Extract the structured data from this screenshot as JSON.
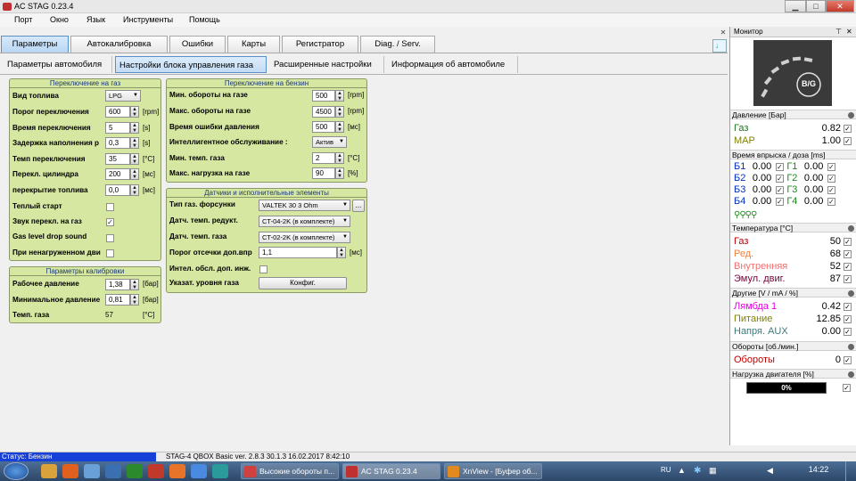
{
  "window": {
    "title": "AC STAG 0.23.4",
    "min": "▁",
    "max": "□",
    "close": "✕"
  },
  "menu": [
    "Порт",
    "Окно",
    "Язык",
    "Инструменты",
    "Помощь"
  ],
  "tabs": [
    "Параметры",
    "Автокалибровка",
    "Ошибки",
    "Карты",
    "Регистратор",
    "Diag. / Serv."
  ],
  "subtabs": [
    "Параметры автомобиля",
    "Настройки блока управления газа",
    "Расширенные настройки",
    "Информация об автомобиле"
  ],
  "gas_switch": {
    "title": "Переключение на газ",
    "fuel_type": {
      "label": "Вид топлива",
      "value": "LPG"
    },
    "threshold": {
      "label": "Порог переключения",
      "value": "600",
      "unit": "[rpm]"
    },
    "time": {
      "label": "Время переключения",
      "value": "5",
      "unit": "[s]"
    },
    "delay": {
      "label": "Задержка наполнения р",
      "value": "0,3",
      "unit": "[s]"
    },
    "temp": {
      "label": "Темп переключения",
      "value": "35",
      "unit": "[°C]"
    },
    "cyl": {
      "label": "Перекл. цилиндра",
      "value": "200",
      "unit": "[мс]"
    },
    "overlap": {
      "label": "перекрытие топлива",
      "value": "0,0",
      "unit": "[мс]"
    },
    "warm_start": {
      "label": "Теплый старт",
      "checked": ""
    },
    "sound": {
      "label": "Звук перекл. на газ",
      "checked": "✓"
    },
    "gas_level": {
      "label": "Gas level drop sound",
      "checked": ""
    },
    "unloaded": {
      "label": "При ненагруженном дви",
      "checked": ""
    }
  },
  "calib": {
    "title": "Параметры калибровки",
    "work_pressure": {
      "label": "Рабочее давление",
      "value": "1,38",
      "unit": "[бар]"
    },
    "min_pressure": {
      "label": "Минимальное давление",
      "value": "0,81",
      "unit": "[бар]"
    },
    "gas_temp": {
      "label": "Темп. газа",
      "value": "57",
      "unit": "[°C]"
    }
  },
  "petrol_switch": {
    "title": "Переключение на бензин",
    "min_rpm": {
      "label": "Мин. обороты на газе",
      "value": "500",
      "unit": "[rpm]"
    },
    "max_rpm": {
      "label": "Макс. обороты на газе",
      "value": "4500",
      "unit": "[rpm]"
    },
    "pressure_err": {
      "label": "Время ошибки давления",
      "value": "500",
      "unit": "[мс]"
    },
    "intel": {
      "label": "Интеллигентное обслуживание :",
      "value": "Актив"
    },
    "min_temp": {
      "label": "Мин. темп. газа",
      "value": "2",
      "unit": "[°C]"
    },
    "max_load": {
      "label": "Макс. нагрузка на газе",
      "value": "90",
      "unit": "[%]"
    }
  },
  "sensors": {
    "title": "Датчики и исполнительные элементы",
    "injector": {
      "label": "Тип газ. форсунки",
      "value": "VALTEK 30 3 Ohm",
      "btn": "..."
    },
    "red_sensor": {
      "label": "Датч. темп. редукт.",
      "value": "CT-04-2K (в комплекте)"
    },
    "gas_sensor": {
      "label": "Датч. темп. газа",
      "value": "CT-02-2K (в комплекте)"
    },
    "cutoff": {
      "label": "Порог отсечки доп.впр",
      "value": "1,1",
      "unit": "[мс]"
    },
    "intel_inj": {
      "label": "Интел. обсл. доп. инж.",
      "checked": ""
    },
    "level": {
      "label": "Указат. уровня газа",
      "btn": "Конфиг."
    }
  },
  "monitor": {
    "title": "Монитор",
    "logo": "B/G",
    "pressure_head": "Давление [Бар]",
    "gas": {
      "name": "Газ",
      "value": "0.82",
      "checked": "✓"
    },
    "map": {
      "name": "MAP",
      "value": "1.00",
      "checked": "✓"
    },
    "inj_head": "Время впрыска / доза [ms]",
    "inj": [
      {
        "b": "Б1",
        "bv": "0.00",
        "g": "Г1",
        "gv": "0.00"
      },
      {
        "b": "Б2",
        "bv": "0.00",
        "g": "Г2",
        "gv": "0.00"
      },
      {
        "b": "Б3",
        "bv": "0.00",
        "g": "Г3",
        "gv": "0.00"
      },
      {
        "b": "Б4",
        "bv": "0.00",
        "g": "Г4",
        "gv": "0.00"
      }
    ],
    "temp_head": "Температура [°C]",
    "temps": [
      {
        "name": "Газ",
        "value": "50",
        "color": "#c00000"
      },
      {
        "name": "Ред.",
        "value": "68",
        "color": "#f08040"
      },
      {
        "name": "Внутренняя",
        "value": "52",
        "color": "#f07070"
      },
      {
        "name": "Эмул. двиг.",
        "value": "87",
        "color": "#800040"
      }
    ],
    "other_head": "Другие [V / mA / %]",
    "others": [
      {
        "name": "Лямбда 1",
        "value": "0.42",
        "color": "#e000e0"
      },
      {
        "name": "Питание",
        "value": "12.85",
        "color": "#808000"
      },
      {
        "name": "Напря. AUX",
        "value": "0.00",
        "color": "#3a7a7a"
      }
    ],
    "rpm_head": "Обороты [об./мин.]",
    "rpm": {
      "name": "Обороты",
      "value": "0",
      "color": "#c00000"
    },
    "load_head": "Нагрузка двигателя [%]",
    "load": {
      "value": "0%",
      "fraction": 0
    }
  },
  "status": {
    "text": "Статус: Бензин",
    "info": "STAG-4 QBOX Basic  ver. 2.8.3  30.1.3   16.02.2017 8:42:10"
  },
  "taskbar": {
    "tasks": [
      "Высокие обороты п...",
      "AC STAG 0.23.4",
      "XnView - [Буфер об..."
    ],
    "clock": "14:22",
    "lang": "RU"
  }
}
